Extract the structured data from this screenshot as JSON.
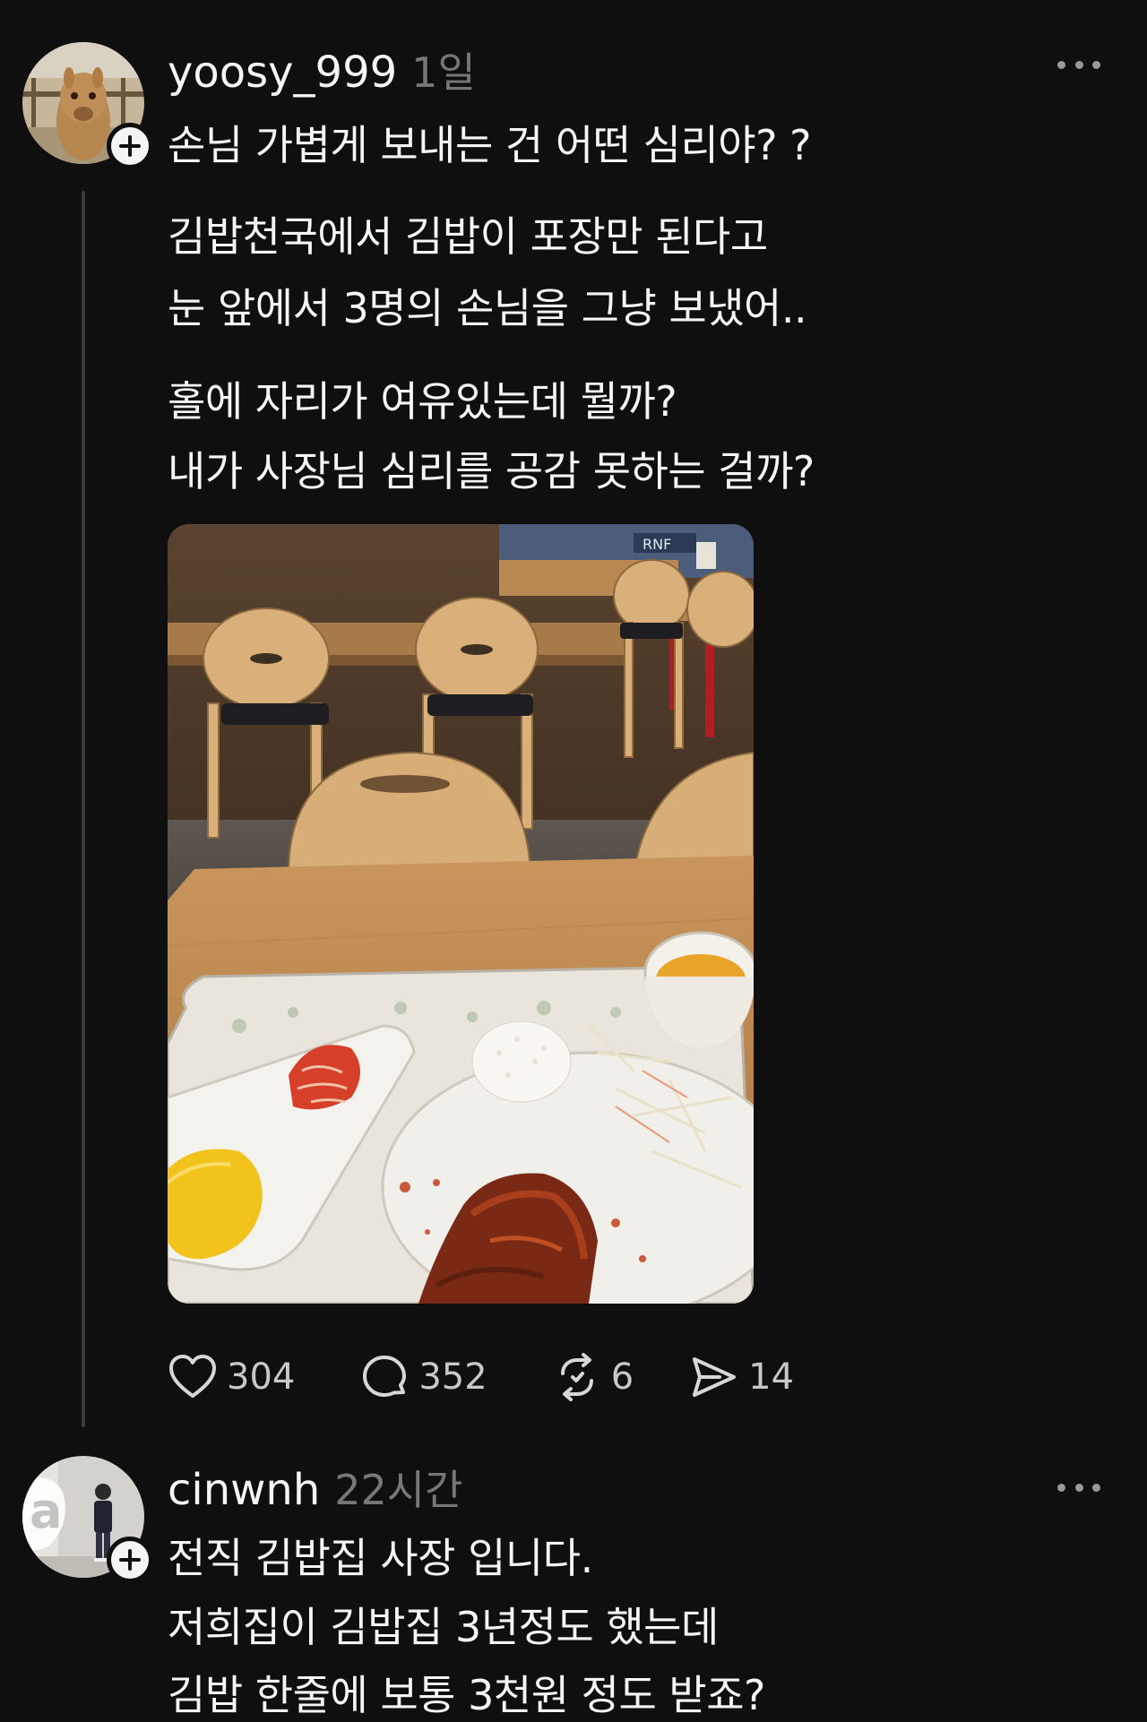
{
  "posts": [
    {
      "username": "yoosy_999",
      "time": "1일",
      "title_line": "손님 가볍게 보내는 건 어떤 심리야? ?",
      "paragraph1": [
        "김밥천국에서 김밥이 포장만 된다고",
        "눈 앞에서 3명의 손님을 그냥 보냈어.."
      ],
      "paragraph2": [
        "홀에 자리가 여유있는데 뭘까?",
        "내가 사장님 심리를 공감 못하는 걸까?"
      ],
      "image": {
        "subject": "restaurant-table-with-tray-of-food",
        "sign_text": "RNF"
      },
      "actions": {
        "likes": "304",
        "replies": "352",
        "reposts": "6",
        "shares": "14"
      },
      "icons": [
        "heart-icon",
        "comment-icon",
        "repost-icon",
        "share-icon",
        "more-icon",
        "plus-icon"
      ]
    },
    {
      "username": "cinwnh",
      "time": "22시간",
      "lines": [
        "전직 김밥집 사장 입니다.",
        "저희집이 김밥집 3년정도 했는데",
        "김밥 한줄에 보통 3천원 정도 받죠?"
      ]
    }
  ],
  "colors": {
    "background": "#0f0f0f",
    "text": "#f3f5f7",
    "muted": "#777777",
    "thread_line": "#3a3a3a"
  }
}
